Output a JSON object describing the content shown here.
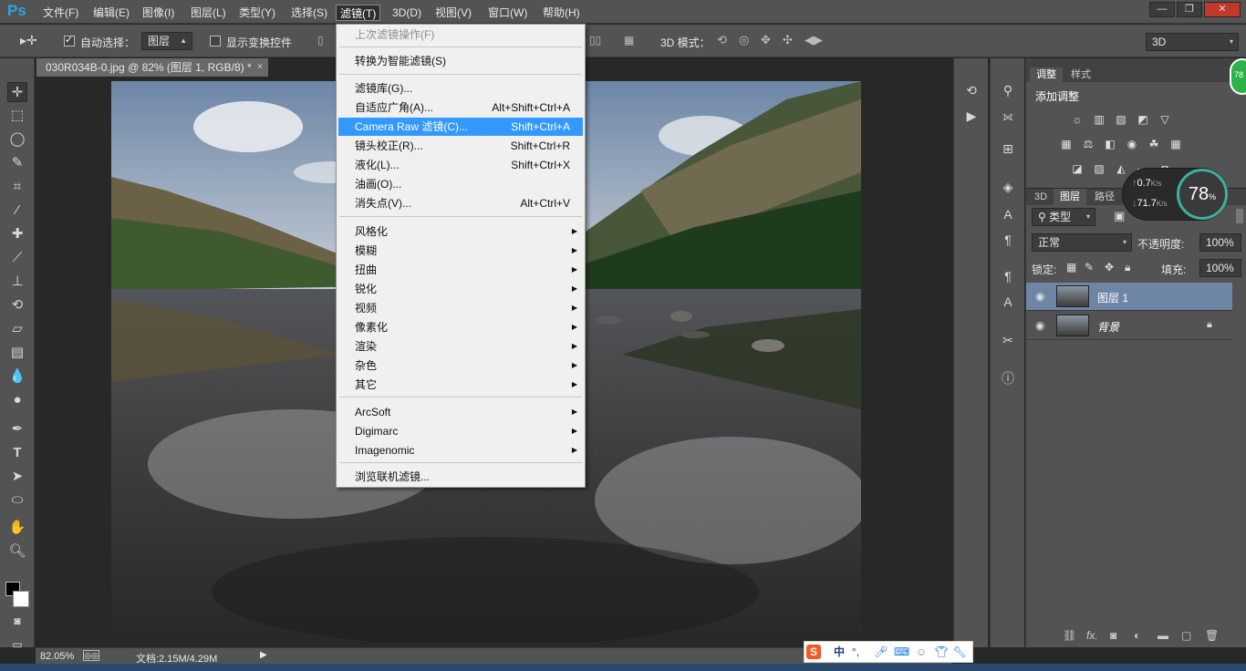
{
  "app": {
    "logo": "Ps"
  },
  "menubar": {
    "items": [
      "文件(F)",
      "编辑(E)",
      "图像(I)",
      "图层(L)",
      "类型(Y)",
      "选择(S)",
      "滤镜(T)",
      "3D(D)",
      "视图(V)",
      "窗口(W)",
      "帮助(H)"
    ],
    "active_index": 6,
    "window_controls": [
      "—",
      "❐",
      "✕"
    ]
  },
  "options": {
    "auto_select_label": "自动选择：",
    "auto_select_checked": true,
    "auto_select_value": "图层",
    "show_transform_label": "显示变换控件",
    "show_transform_checked": false,
    "mode_3d_label": "3D 模式：",
    "workspace_value": "3D"
  },
  "document": {
    "tab_title": "030R034B-0.jpg @ 82% (图层 1, RGB/8) *",
    "close_label": "×"
  },
  "status": {
    "zoom": "82.05%",
    "doc_size": "文档:2.15M/4.29M"
  },
  "filter_menu": {
    "last_filter": "上次滤镜操作(F)",
    "convert_smart": "转换为智能滤镜(S)",
    "group1": [
      {
        "label": "滤镜库(G)...",
        "shortcut": ""
      },
      {
        "label": "自适应广角(A)...",
        "shortcut": "Alt+Shift+Ctrl+A"
      },
      {
        "label": "Camera Raw 滤镜(C)...",
        "shortcut": "Shift+Ctrl+A"
      },
      {
        "label": "镜头校正(R)...",
        "shortcut": "Shift+Ctrl+R"
      },
      {
        "label": "液化(L)...",
        "shortcut": "Shift+Ctrl+X"
      },
      {
        "label": "油画(O)...",
        "shortcut": ""
      },
      {
        "label": "消失点(V)...",
        "shortcut": "Alt+Ctrl+V"
      }
    ],
    "group2": [
      "风格化",
      "模糊",
      "扭曲",
      "锐化",
      "视频",
      "像素化",
      "渲染",
      "杂色",
      "其它"
    ],
    "group3": [
      "ArcSoft",
      "Digimarc",
      "Imagenomic"
    ],
    "browse_online": "浏览联机滤镜...",
    "highlight_index": 2
  },
  "adjustments_panel": {
    "tabs": [
      "调整",
      "样式"
    ],
    "title": "添加调整"
  },
  "layers_panel": {
    "tabs": [
      "3D",
      "图层",
      "路径"
    ],
    "kind_filter": "类型",
    "blend_mode": "正常",
    "opacity_label": "不透明度:",
    "opacity_value": "100%",
    "lock_label": "锁定:",
    "fill_label": "填充:",
    "fill_value": "100%",
    "layers": [
      {
        "name": "图层 1",
        "selected": true,
        "locked": false
      },
      {
        "name": "背景",
        "selected": false,
        "locked": true
      }
    ]
  },
  "speed_widget": {
    "up": "0.7",
    "up_unit": "K/s",
    "down": "71.7",
    "down_unit": "K/s",
    "percent": "78",
    "percent_sign": "%"
  },
  "corner_badge": "78",
  "ime": {
    "lang": "中"
  }
}
